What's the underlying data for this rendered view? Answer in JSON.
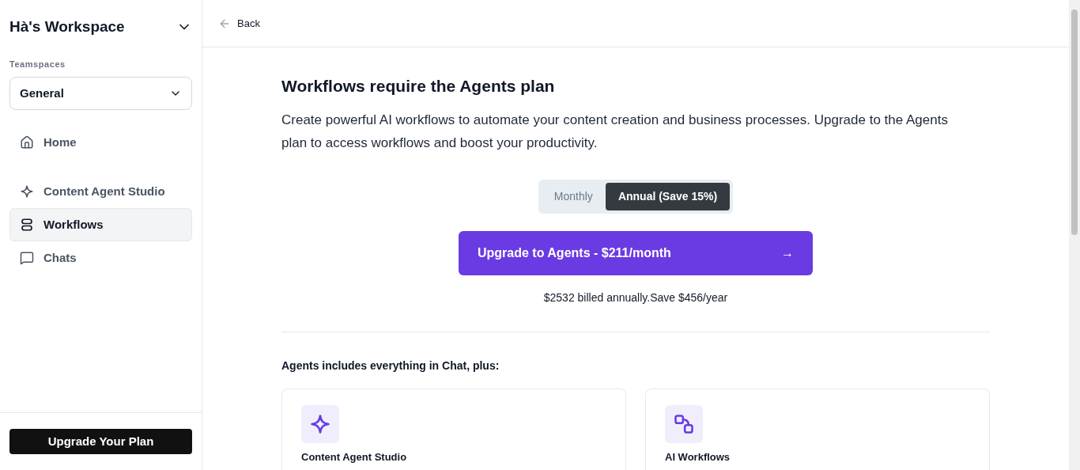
{
  "sidebar": {
    "workspace": "Hà's Workspace",
    "teamspaces_label": "Teamspaces",
    "teamspace": "General",
    "items": [
      {
        "label": "Home",
        "selected": false
      },
      {
        "label": "Content Agent Studio",
        "selected": false
      },
      {
        "label": "Workflows",
        "selected": true
      },
      {
        "label": "Chats",
        "selected": false
      }
    ],
    "upgrade_button": "Upgrade Your Plan"
  },
  "header": {
    "back": "Back"
  },
  "main": {
    "title": "Workflows require the Agents plan",
    "description": "Create powerful AI workflows to automate your content creation and business processes. Upgrade to the Agents plan to access workflows and boost your productivity.",
    "billing": [
      {
        "label": "Monthly",
        "selected": false
      },
      {
        "label": "Annual (Save 15%)",
        "selected": true
      }
    ],
    "cta": "Upgrade to Agents - $211/month",
    "cta_arrow": "→",
    "billing_note": "$2532 billed annually.Save $456/year",
    "features_heading": "Agents includes everything in Chat, plus:",
    "features": [
      {
        "title": "Content Agent Studio"
      },
      {
        "title": "AI Workflows"
      }
    ]
  }
}
